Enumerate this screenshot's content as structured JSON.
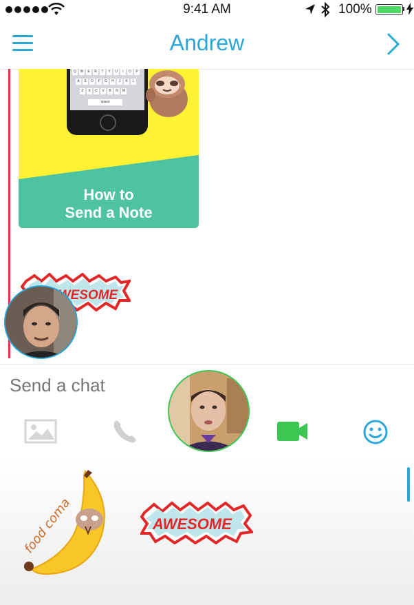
{
  "status_bar": {
    "time": "9:41 AM",
    "battery": "100%",
    "battery_level": 1.0
  },
  "header": {
    "title": "Andrew",
    "menu_icon": "hamburger-icon",
    "forward_icon": "chevron-right-icon"
  },
  "messages": {
    "card": {
      "title_line1": "How to",
      "title_line2": "Send a Note"
    },
    "sticker_text": "AWESOME"
  },
  "compose": {
    "placeholder": "Send a chat",
    "icons": [
      "image-icon",
      "phone-icon",
      "video-icon",
      "smile-icon"
    ]
  },
  "tray": {
    "sticker1_text": "food coma",
    "sticker2_text": "AWESOME"
  },
  "colors": {
    "accent": "#2aa7d6",
    "thread_line": "#e8354b",
    "video_green": "#3cc654",
    "card_yellow": "#fef233",
    "card_teal": "#4ec3a2"
  }
}
